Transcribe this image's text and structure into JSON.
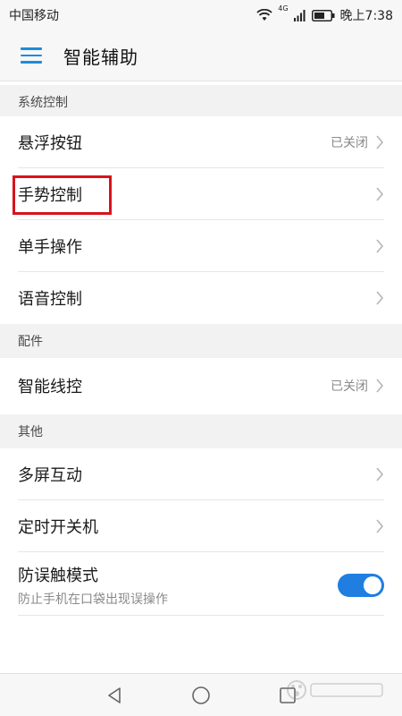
{
  "status_bar": {
    "carrier": "中国移动",
    "network": "4G",
    "time": "晚上7:38"
  },
  "header": {
    "title": "智能辅助"
  },
  "sections": {
    "system_control": {
      "title": "系统控制",
      "items": [
        {
          "label": "悬浮按钮",
          "value": "已关闭"
        },
        {
          "label": "手势控制",
          "value": ""
        },
        {
          "label": "单手操作",
          "value": ""
        },
        {
          "label": "语音控制",
          "value": ""
        }
      ]
    },
    "accessories": {
      "title": "配件",
      "items": [
        {
          "label": "智能线控",
          "value": "已关闭"
        }
      ]
    },
    "other": {
      "title": "其他",
      "items": [
        {
          "label": "多屏互动",
          "value": ""
        },
        {
          "label": "定时开关机",
          "value": ""
        },
        {
          "label": "防误触模式",
          "sub": "防止手机在口袋出现误操作",
          "toggle": true
        }
      ]
    }
  },
  "colors": {
    "accent": "#1f7ee0",
    "highlight": "#d8131c"
  }
}
